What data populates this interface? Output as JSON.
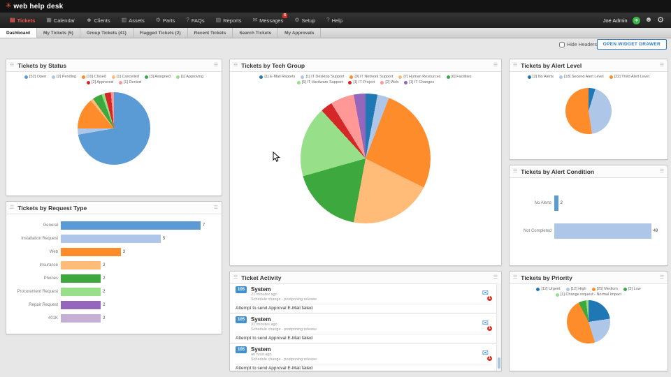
{
  "topbar": {
    "logo_text": "web help desk"
  },
  "menubar": {
    "items": [
      {
        "label": "Tickets",
        "icon": "tickets-icon",
        "active": true
      },
      {
        "label": "Calendar",
        "icon": "calendar-icon"
      },
      {
        "label": "Clients",
        "icon": "clients-icon"
      },
      {
        "label": "Assets",
        "icon": "assets-icon"
      },
      {
        "label": "Parts",
        "icon": "parts-icon"
      },
      {
        "label": "FAQs",
        "icon": "faqs-icon"
      },
      {
        "label": "Reports",
        "icon": "reports-icon"
      },
      {
        "label": "Messages",
        "icon": "messages-icon",
        "badge": "5"
      },
      {
        "label": "Setup",
        "icon": "setup-icon"
      },
      {
        "label": "Help",
        "icon": "help-icon"
      }
    ],
    "user_name": "Joe Admin"
  },
  "tabs": [
    {
      "label": "Dashboard",
      "active": true
    },
    {
      "label": "My Tickets (5)"
    },
    {
      "label": "Group Tickets (41)"
    },
    {
      "label": "Flagged Tickets (2)"
    },
    {
      "label": "Recent Tickets"
    },
    {
      "label": "Search Tickets"
    },
    {
      "label": "My Approvals"
    }
  ],
  "toolbar": {
    "hide_headers_label": "Hide Headers",
    "open_widget_drawer_label": "OPEN WIDGET DRAWER"
  },
  "widgets": {
    "status": {
      "title": "Tickets by Status",
      "chart": {
        "type": "pie",
        "series": [
          {
            "label": "[52] Open",
            "value": 52,
            "color": "#5b9bd5"
          },
          {
            "label": "[2] Pending",
            "value": 2,
            "color": "#aec7e8"
          },
          {
            "label": "[10] Closed",
            "value": 10,
            "color": "#ff8c2b"
          },
          {
            "label": "[1] Cancelled",
            "value": 1,
            "color": "#ffbb78"
          },
          {
            "label": "[3] Assigned",
            "value": 3,
            "color": "#3da83d"
          },
          {
            "label": "[1] Approving",
            "value": 1,
            "color": "#98df8a"
          },
          {
            "label": "[2] Approved",
            "value": 2,
            "color": "#d62728"
          },
          {
            "label": "[1] Denied",
            "value": 1,
            "color": "#ff9896"
          }
        ]
      }
    },
    "reqtype": {
      "title": "Tickets by Request Type",
      "chart": {
        "type": "bar-horizontal",
        "categories": [
          "General",
          "Installation Request",
          "Web",
          "Insurance",
          "Phones",
          "Procurement Request",
          "Repair Request",
          "401K"
        ],
        "values": [
          7,
          5,
          3,
          2,
          2,
          2,
          2,
          2
        ],
        "colors": [
          "#5b9bd5",
          "#aec7e8",
          "#ff8c2b",
          "#ffbb78",
          "#3da83d",
          "#98df8a",
          "#9467bd",
          "#c5b0d5"
        ],
        "xmax": 7
      }
    },
    "techgroup": {
      "title": "Tickets by Tech Group",
      "chart": {
        "type": "pie",
        "series": [
          {
            "label": "[1] E-Mail Reports",
            "value": 1,
            "color": "#1f77b4"
          },
          {
            "label": "[1] IT Desktop Support",
            "value": 1,
            "color": "#aec7e8"
          },
          {
            "label": "[9] IT Network Support",
            "value": 9,
            "color": "#ff8c2b"
          },
          {
            "label": "[7] Human Resources",
            "value": 7,
            "color": "#ffbb78"
          },
          {
            "label": "[6] Facilities",
            "value": 6,
            "color": "#3da83d"
          },
          {
            "label": "[6] IT Hardware Support",
            "value": 6,
            "color": "#98df8a"
          },
          {
            "label": "[1] IT Project",
            "value": 1,
            "color": "#d62728"
          },
          {
            "label": "[2] Web",
            "value": 2,
            "color": "#ff9896"
          },
          {
            "label": "[1] IT Changes",
            "value": 1,
            "color": "#9467bd"
          }
        ]
      }
    },
    "activity": {
      "title": "Ticket Activity",
      "items": [
        {
          "badge": "105",
          "actor": "System",
          "time": "21 minutes ago",
          "action": "Schedule change - postponing release",
          "detail": "Attempt to send Approval E-Mail failed",
          "mail_badge": "1"
        },
        {
          "badge": "105",
          "actor": "System",
          "time": "31 minutes ago",
          "action": "Schedule change - postponing release",
          "detail": "Attempt to send Approval E-Mail failed",
          "mail_badge": "1"
        },
        {
          "badge": "105",
          "actor": "System",
          "time": "an hour ago",
          "action": "Schedule change - postponing release",
          "detail": "Attempt to send Approval E-Mail failed",
          "mail_badge": "1"
        }
      ]
    },
    "alertlevel": {
      "title": "Tickets by Alert Level",
      "chart": {
        "type": "pie",
        "series": [
          {
            "label": "[2] No Alerts",
            "value": 2,
            "color": "#1f77b4"
          },
          {
            "label": "[18] Second Alert Level",
            "value": 18,
            "color": "#aec7e8"
          },
          {
            "label": "[22] Third Alert Level",
            "value": 22,
            "color": "#ff8c2b"
          }
        ]
      }
    },
    "alertcond": {
      "title": "Tickets by Alert Condition",
      "chart": {
        "type": "bar-horizontal",
        "categories": [
          "No Alerts",
          "Not Completed"
        ],
        "values": [
          2,
          49
        ],
        "colors": [
          "#5b9bd5",
          "#aec7e8"
        ],
        "xmax": 49
      }
    },
    "priority": {
      "title": "Tickets by Priority",
      "chart": {
        "type": "pie",
        "series": [
          {
            "label": "[12] Urgent",
            "value": 12,
            "color": "#1f77b4"
          },
          {
            "label": "[12] High",
            "value": 12,
            "color": "#aec7e8"
          },
          {
            "label": "[25] Medium",
            "value": 25,
            "color": "#ff8c2b"
          },
          {
            "label": "[3] Low",
            "value": 3,
            "color": "#3da83d"
          },
          {
            "label": "[1] Change request - Normal Impact",
            "value": 1,
            "color": "#98df8a"
          }
        ]
      }
    }
  }
}
